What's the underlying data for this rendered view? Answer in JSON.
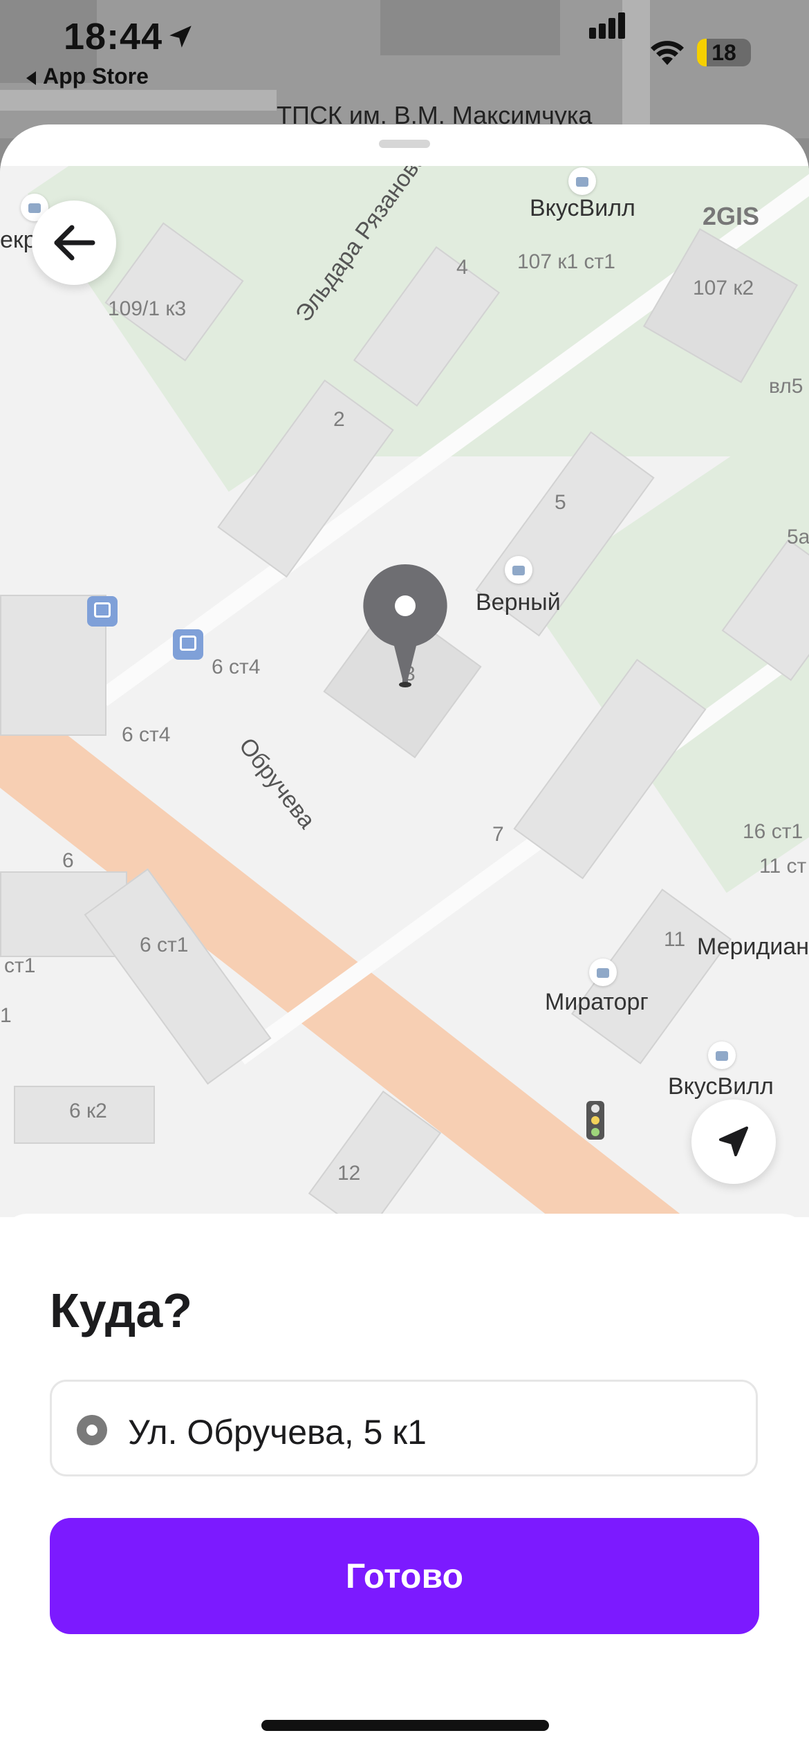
{
  "status_bar": {
    "time": "18:44",
    "back_app": "App Store",
    "battery_level": "18"
  },
  "background": {
    "label": "ТПСК им. В.М. Максимчука"
  },
  "map": {
    "logo": "2GIS",
    "streets": [
      "Эльдара Рязанова",
      "Обручева"
    ],
    "building_numbers": [
      "109/1 к3",
      "4",
      "107 к1 ст1",
      "107 к2",
      "вл5",
      "2",
      "5",
      "5а",
      "6 ст4",
      "6 ст4",
      "3",
      "7",
      "16 ст1",
      "11 ст",
      "6",
      "6 ст1",
      "ст1",
      "1",
      "11",
      "6 к2",
      "12"
    ],
    "pois": [
      "ВкусВилл",
      "Верный",
      "Меридиан",
      "Мираторг",
      "ВкусВилл",
      "екр"
    ]
  },
  "sheet": {
    "heading": "Куда?",
    "address_value": "Ул. Обручева, 5 к1",
    "done_label": "Готово"
  },
  "icons": {
    "back": "arrow-left-icon",
    "locate": "navigation-arrow-icon",
    "pin": "map-pin-icon"
  },
  "colors": {
    "accent": "#7c1aff",
    "main_road": "#f7cfb3",
    "park": "#e1ecde"
  }
}
